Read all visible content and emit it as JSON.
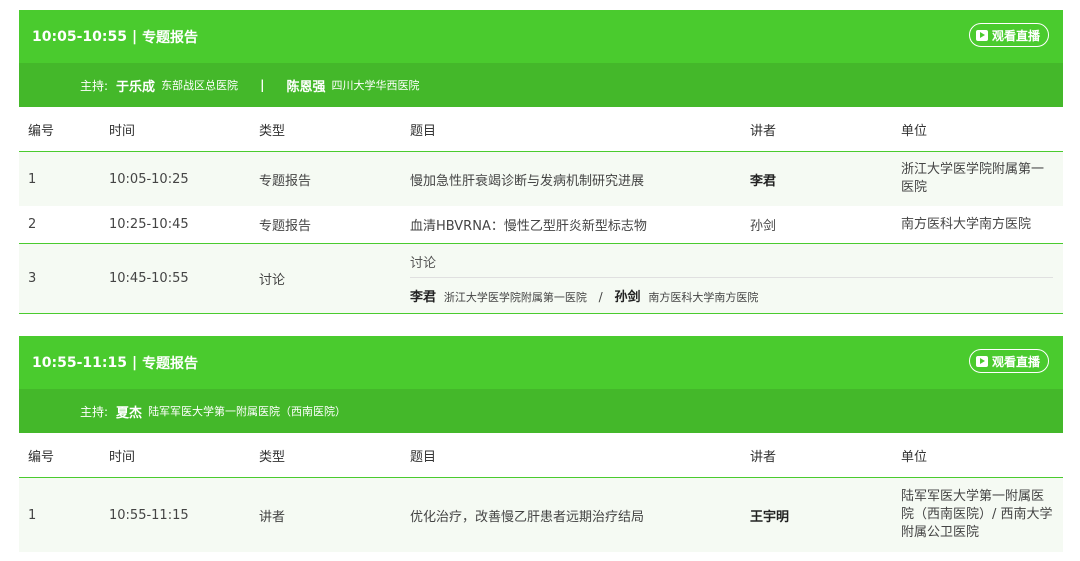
{
  "columns": {
    "no": "编号",
    "time": "时间",
    "type": "类型",
    "topic": "题目",
    "speaker": "讲者",
    "unit": "单位"
  },
  "session1": {
    "time": "10:05-10:55",
    "sep": "|",
    "kind": "专题报告",
    "watch": "观看直播",
    "host_label": "主持:",
    "hosts": [
      {
        "name": "于乐成",
        "org": "东部战区总医院"
      },
      {
        "name": "陈恩强",
        "org": "四川大学华西医院"
      }
    ],
    "host_divider": "|",
    "rows": [
      {
        "no": "1",
        "time": "10:05-10:25",
        "type": "专题报告",
        "topic": "慢加急性肝衰竭诊断与发病机制研究进展",
        "speaker": "李君",
        "unit": "浙江大学医学院附属第一医院"
      },
      {
        "no": "2",
        "time": "10:25-10:45",
        "type": "专题报告",
        "topic": "血清HBVRNA：慢性乙型肝炎新型标志物",
        "speaker": "孙剑",
        "unit": "南方医科大学南方医院"
      }
    ],
    "discussion": {
      "no": "3",
      "time": "10:45-10:55",
      "type": "讨论",
      "topic": "讨论",
      "sep": "/",
      "people": [
        {
          "name": "李君",
          "org": "浙江大学医学院附属第一医院"
        },
        {
          "name": "孙剑",
          "org": "南方医科大学南方医院"
        }
      ]
    }
  },
  "session2": {
    "time": "10:55-11:15",
    "sep": "|",
    "kind": "专题报告",
    "watch": "观看直播",
    "host_label": "主持:",
    "host": {
      "name": "夏杰",
      "org": "陆军军医大学第一附属医院（西南医院）"
    },
    "rows": [
      {
        "no": "1",
        "time": "10:55-11:15",
        "type": "讲者",
        "topic": "优化治疗，改善慢乙肝患者远期治疗结局",
        "speaker": "王宇明",
        "unit": "陆军军医大学第一附属医院（西南医院）/ 西南大学附属公卫医院"
      }
    ]
  },
  "colors": {
    "header_green": "#4acb2e",
    "host_green": "#44b82a",
    "row_alt": "#f5faf3"
  },
  "icons": {
    "watch": "play-icon"
  }
}
